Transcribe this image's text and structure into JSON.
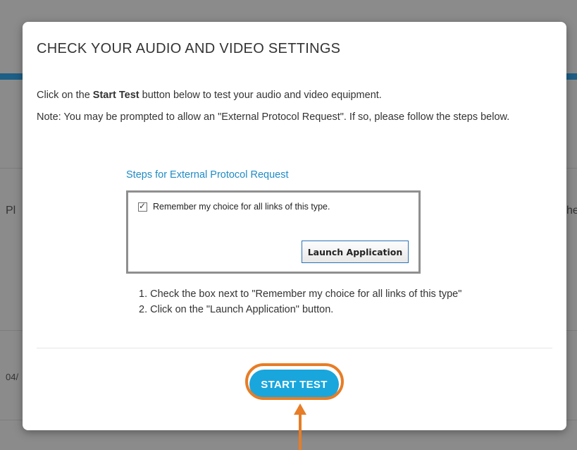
{
  "background": {
    "left_fragment_1": "Pl",
    "right_fragment_1": "he",
    "left_fragment_2": "04/"
  },
  "modal": {
    "title": "CHECK YOUR AUDIO AND VIDEO SETTINGS",
    "intro_prefix": "Click on the ",
    "intro_bold": "Start Test",
    "intro_suffix": " button below to test your audio and video equipment.",
    "note": "Note: You may be prompted to allow an \"External Protocol Request\". If so, please follow the steps below.",
    "steps_title": "Steps for External Protocol Request",
    "protocol_dialog": {
      "checkbox_label": "Remember my choice for all links of this type.",
      "checkbox_checked": true,
      "launch_button": "Launch Application"
    },
    "instructions": [
      "1. Check the box next to \"Remember my choice for all links of this type\"",
      "2. Click on the \"Launch Application\" button."
    ],
    "start_test_button": "START TEST"
  },
  "colors": {
    "accent": "#19a6dd",
    "link": "#1f8bc6",
    "highlight": "#e77d26",
    "overlay": "#8b8b8b"
  },
  "icons": {
    "checkbox": "check-icon",
    "annotation": "arrow-up-icon"
  }
}
